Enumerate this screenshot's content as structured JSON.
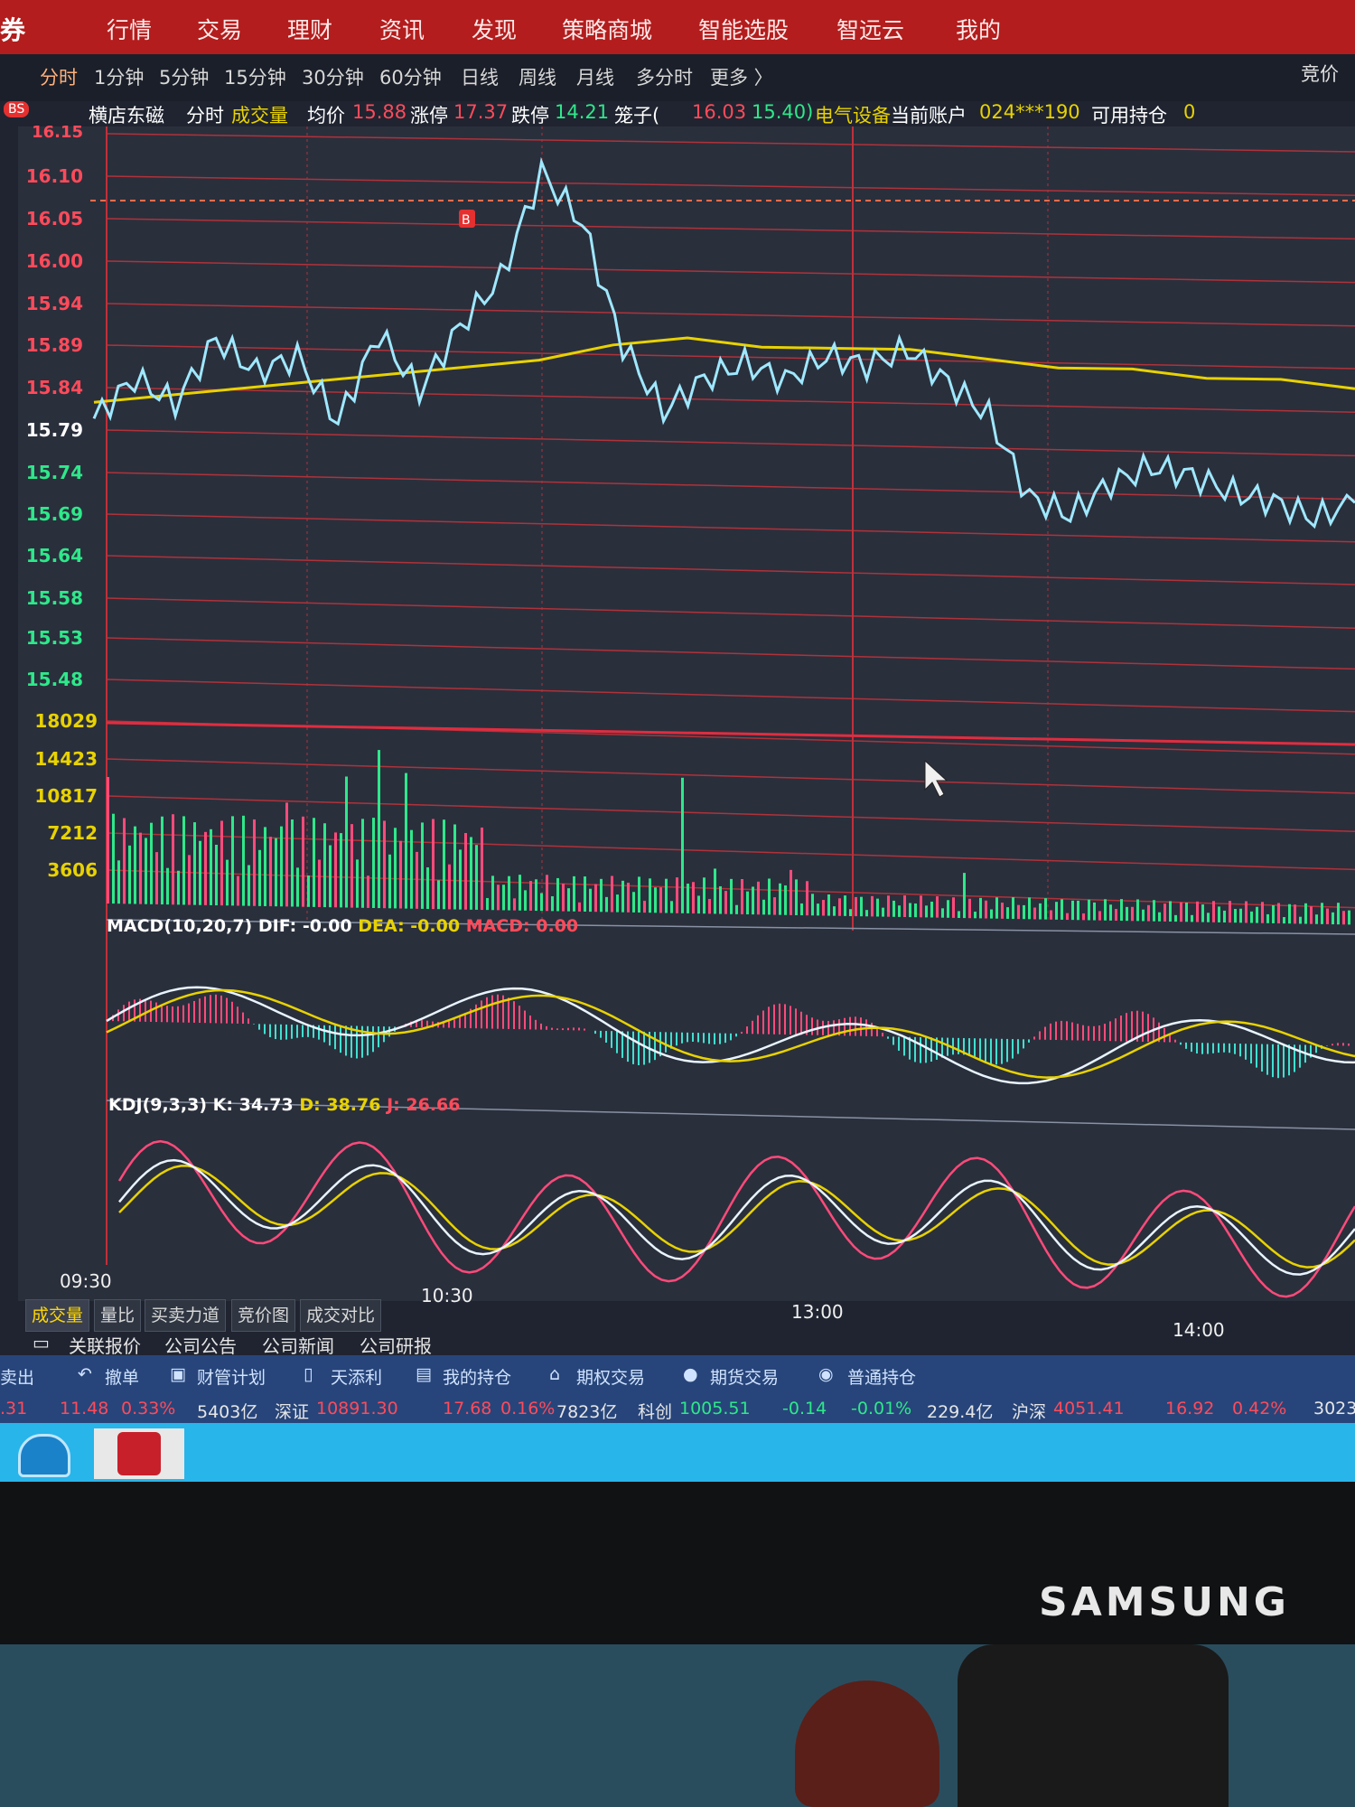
{
  "menu": {
    "brand": "券",
    "items": [
      "行情",
      "交易",
      "理财",
      "资讯",
      "发现",
      "策略商城",
      "智能选股",
      "智远云",
      "我的"
    ]
  },
  "timeframes": {
    "items": [
      "分时",
      "1分钟",
      "5分钟",
      "15分钟",
      "30分钟",
      "60分钟",
      "日线",
      "周线",
      "月线",
      "多分时",
      "更多 〉"
    ],
    "active": "分时",
    "compete": "竞价"
  },
  "info": {
    "badge": "BS",
    "stock": "横店东磁",
    "view": "分时",
    "vol_label": "成交量",
    "avg_label": "均价",
    "avg": "15.88",
    "limit_up_label": "涨停",
    "limit_up": "17.37",
    "limit_down_label": "跌停",
    "limit_down": "14.21",
    "cage_label": "笼子(",
    "cage_a": "16.03",
    "cage_b": "15.40)",
    "sector": "电气设备",
    "account_label": "当前账户",
    "account": "024***190",
    "holding_label": "可用持仓",
    "holding": "0"
  },
  "price_axis": [
    "16.15",
    "16.10",
    "16.05",
    "16.00",
    "15.94",
    "15.89",
    "15.84",
    "15.79",
    "15.74",
    "15.69",
    "15.64",
    "15.58",
    "15.53",
    "15.48"
  ],
  "volume_axis": [
    "18029",
    "14423",
    "10817",
    "7212",
    "3606"
  ],
  "macd": {
    "label": "MACD(10,20,7)",
    "dif_label": "DIF:",
    "dif": "-0.00",
    "dea_label": "DEA:",
    "dea": "-0.00",
    "macd_label": "MACD:",
    "macd": "0.00"
  },
  "kdj": {
    "label": "KDJ(9,3,3)",
    "k_label": "K:",
    "k": "34.73",
    "d_label": "D:",
    "d": "38.76",
    "j_label": "J:",
    "j": "26.66"
  },
  "times": [
    "09:30",
    "10:30",
    "13:00",
    "14:00"
  ],
  "bottom_tabs": [
    "成交量",
    "量比",
    "买卖力道",
    "竞价图",
    "成交对比"
  ],
  "related": [
    "关联报价",
    "公司公告",
    "公司新闻",
    "公司研报"
  ],
  "trade": [
    "卖出",
    "撤单",
    "财管计划",
    "天添利",
    "我的持仓",
    "期权交易",
    "期货交易",
    "普通持仓"
  ],
  "indices": {
    "a0": ".31",
    "a1": "11.48",
    "a2": "0.33%",
    "a3": "5403亿",
    "sz_label": "深证",
    "sz": "10891.30",
    "sz_chg": "17.68",
    "sz_pct": "0.16%",
    "sz_amt": "7823亿",
    "kc_label": "科创",
    "kc": "1005.51",
    "kc_chg": "-0.14",
    "kc_pct": "-0.01%",
    "kc_amt": "229.4亿",
    "hs_label": "沪深",
    "hs": "4051.41",
    "hs_chg": "16.92",
    "hs_pct": "0.42%",
    "tail": "3023"
  },
  "monitor_brand": "SAMSUNG",
  "colors": {
    "price_line": "#9fe8ff",
    "avg_line": "#e8d200",
    "up": "#ff4a7a",
    "down": "#2ee88a",
    "grid": "#b0323a"
  },
  "chart_data": {
    "type": "line",
    "title": "横店东磁 分时",
    "x": [
      "09:30",
      "10:30",
      "13:00",
      "14:00"
    ],
    "series": [
      {
        "name": "price",
        "values": [
          15.8,
          15.85,
          15.82,
          15.9,
          15.86,
          15.88,
          15.8,
          15.91,
          15.84,
          15.92,
          15.98,
          16.11,
          16.05,
          15.9,
          15.82,
          15.86,
          15.88,
          15.86,
          15.89,
          15.88,
          15.9,
          15.86,
          15.82,
          15.72,
          15.7,
          15.74,
          15.76,
          15.75,
          15.73,
          15.72,
          15.7,
          15.72
        ]
      },
      {
        "name": "avg",
        "values": [
          15.82,
          15.83,
          15.84,
          15.85,
          15.86,
          15.87,
          15.88,
          15.9,
          15.91,
          15.9,
          15.9,
          15.9,
          15.89,
          15.88,
          15.88,
          15.87,
          15.87,
          15.86
        ]
      }
    ],
    "ylim": [
      15.48,
      16.15
    ]
  }
}
